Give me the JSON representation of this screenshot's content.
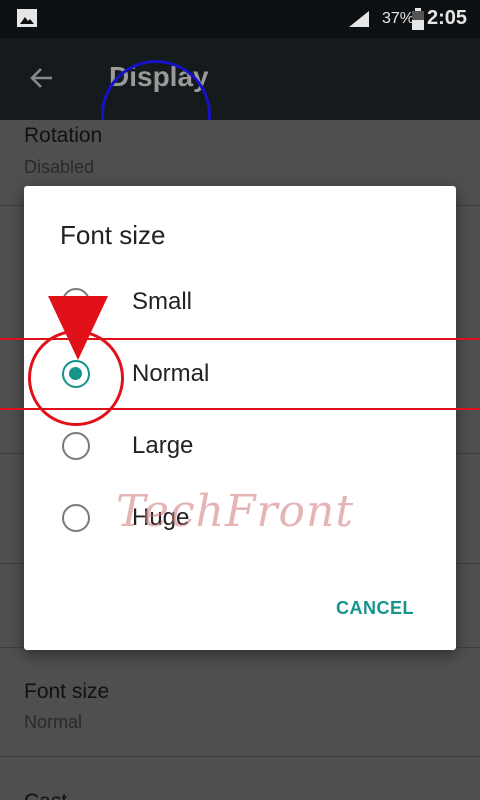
{
  "status_bar": {
    "battery": "37%",
    "time": "2:05"
  },
  "toolbar": {
    "title": "Display"
  },
  "settings": {
    "rotation": {
      "title": "Rotation",
      "value": "Disabled"
    },
    "font_size": {
      "title": "Font size",
      "value": "Normal"
    },
    "cast_partial": "Cast"
  },
  "dialog": {
    "title": "Font size",
    "options": [
      {
        "label": "Small",
        "checked": false
      },
      {
        "label": "Normal",
        "checked": true
      },
      {
        "label": "Large",
        "checked": false
      },
      {
        "label": "Huge",
        "checked": false
      }
    ],
    "cancel_label": "CANCEL"
  },
  "watermark": "TechFront",
  "colors": {
    "accent": "#15958a",
    "annotation_red": "#e1111a",
    "annotation_blue": "#1612c8",
    "toolbar_bg": "#151a1c"
  }
}
